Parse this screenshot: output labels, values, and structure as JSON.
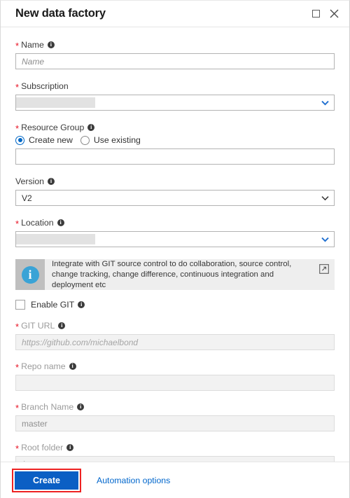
{
  "window": {
    "title": "New data factory",
    "maximize_icon": "maximize-square-icon",
    "close_icon": "close-x-icon"
  },
  "form": {
    "name": {
      "label": "Name",
      "required": true,
      "info_icon": "info-icon",
      "placeholder": "Name",
      "value": ""
    },
    "subscription": {
      "label": "Subscription",
      "required": true,
      "value": "",
      "redacted": true,
      "chevron_icon": "chevron-down-icon",
      "chevron_color": "#1f6fd0"
    },
    "resource_group": {
      "label": "Resource Group",
      "required": true,
      "info_icon": "info-icon",
      "options": [
        {
          "label": "Create new",
          "selected": true
        },
        {
          "label": "Use existing",
          "selected": false
        }
      ],
      "value": "",
      "placeholder": ""
    },
    "version": {
      "label": "Version",
      "required": false,
      "info_icon": "info-icon",
      "value": "V2",
      "chevron_icon": "chevron-down-icon",
      "chevron_color": "#333333"
    },
    "location": {
      "label": "Location",
      "required": true,
      "info_icon": "info-icon",
      "value": "",
      "redacted": true,
      "chevron_icon": "chevron-down-icon",
      "chevron_color": "#1f6fd0"
    },
    "git_banner": {
      "icon": "info-circle-icon",
      "glyph": "i",
      "text": "Integrate with GIT source control to do collaboration, source control, change tracking, change difference, continuous integration and deployment etc",
      "link_icon": "external-link-icon"
    },
    "enable_git": {
      "label": "Enable GIT",
      "checked": false,
      "info_icon": "info-icon"
    },
    "git_url": {
      "label": "GIT URL",
      "required": true,
      "info_icon": "info-icon",
      "placeholder": "https://github.com/michaelbond",
      "value": "",
      "disabled": true
    },
    "repo_name": {
      "label": "Repo name",
      "required": true,
      "info_icon": "info-icon",
      "placeholder": "",
      "value": "",
      "disabled": true
    },
    "branch_name": {
      "label": "Branch Name",
      "required": true,
      "info_icon": "info-icon",
      "placeholder": "master",
      "value": "",
      "disabled": true
    },
    "root_folder": {
      "label": "Root folder",
      "required": true,
      "info_icon": "info-icon",
      "placeholder": "/",
      "value": "",
      "disabled": true
    }
  },
  "footer": {
    "create_label": "Create",
    "automation_label": "Automation options",
    "create_button_color": "#0b5fc4",
    "highlight_color": "#ee2222",
    "link_color": "#0066cc"
  }
}
